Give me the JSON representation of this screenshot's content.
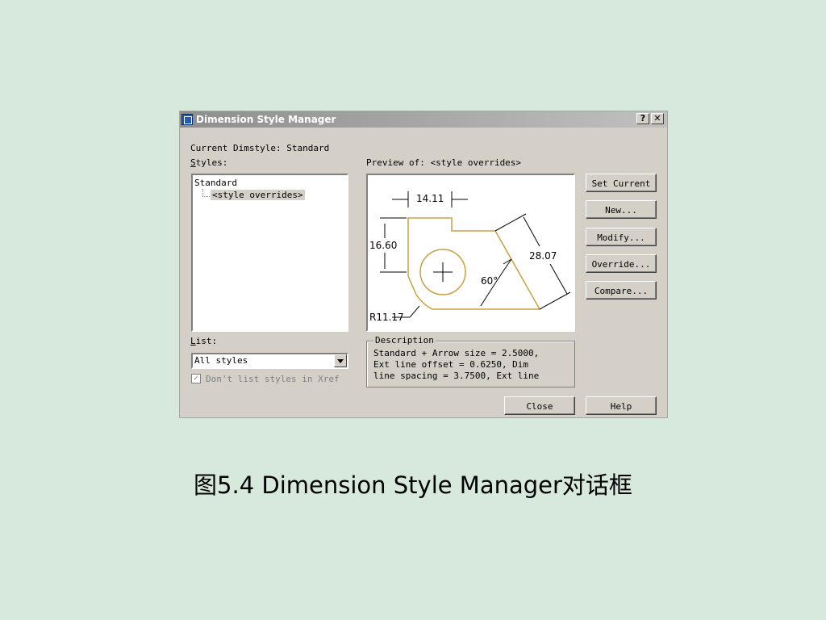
{
  "dialog": {
    "title": "Dimension Style Manager",
    "help_glyph": "?",
    "close_glyph": "✕",
    "current_dimstyle": "Current Dimstyle: Standard",
    "styles_label": "tyles:",
    "styles_label_accel": "S",
    "styles": [
      "Standard",
      "<style overrides>"
    ],
    "preview_label": "Preview of: <style overrides>",
    "preview_dims": {
      "top": "14.11",
      "left": "16.60",
      "right": "28.07",
      "angle": "60°",
      "radius": "R11.17"
    },
    "buttons": {
      "set_current": "Set Current",
      "new": "New...",
      "modify": "Modify...",
      "override": "Override...",
      "compare": "Compare..."
    },
    "list_label": "ist:",
    "list_label_accel": "L",
    "list_value": "All styles",
    "dont_list_xref": "Don't list styles in Xref",
    "description_label": "Description",
    "description_lines": [
      "Standard + Arrow size = 2.5000,",
      "Ext line offset = 0.6250, Dim",
      "line spacing = 3.7500, Ext line"
    ],
    "close_button": "Close",
    "help_button": "Help"
  },
  "caption": "图5.4  Dimension Style Manager对话框",
  "colors": {
    "background": "#d7e9dc",
    "dialog_face": "#d4d0c8",
    "preview_geometry": "#c8a040"
  }
}
